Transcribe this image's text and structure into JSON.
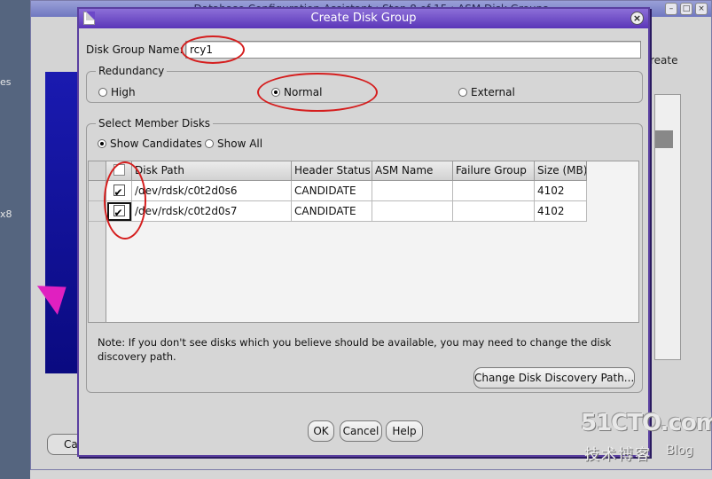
{
  "background_window": {
    "title": "Database Configuration Assistant : Step 8 of 15 : ASM Disk Groups",
    "left_fragments": [
      "es",
      "x8"
    ],
    "right_fragment": "reate",
    "cancel_fragment": "Ca"
  },
  "dialog": {
    "title": "Create Disk Group",
    "disk_group_name_label": "Disk Group Name:",
    "disk_group_name_value": "rcy1",
    "redundancy": {
      "title": "Redundancy",
      "options": [
        {
          "label": "High",
          "selected": false
        },
        {
          "label": "Normal",
          "selected": true
        },
        {
          "label": "External",
          "selected": false
        }
      ]
    },
    "member_disks": {
      "title": "Select Member Disks",
      "filter_options": [
        {
          "label": "Show Candidates",
          "selected": true
        },
        {
          "label": "Show All",
          "selected": false
        }
      ],
      "columns": [
        "",
        "Disk Path",
        "Header Status",
        "ASM Name",
        "Failure Group",
        "Size (MB)"
      ],
      "rows": [
        {
          "checked": true,
          "disk_path": "/dev/rdsk/c0t2d0s6",
          "header_status": "CANDIDATE",
          "asm_name": "",
          "failure_group": "",
          "size_mb": "4102"
        },
        {
          "checked": true,
          "disk_path": "/dev/rdsk/c0t2d0s7",
          "header_status": "CANDIDATE",
          "asm_name": "",
          "failure_group": "",
          "size_mb": "4102"
        }
      ],
      "note": "Note: If you don't see disks which you believe should be available, you may need to change the disk discovery path.",
      "change_path_button": "Change Disk Discovery Path..."
    },
    "buttons": {
      "ok": "OK",
      "cancel": "Cancel",
      "help": "Help"
    }
  },
  "watermark": {
    "logo": "51CTO.com",
    "sub": "技术博客",
    "blog": "Blog"
  },
  "colors": {
    "dialog_title_bar": "#6f4fc8",
    "annotation_red": "#d51e1e",
    "dialog_body": "#d6d6d6"
  }
}
